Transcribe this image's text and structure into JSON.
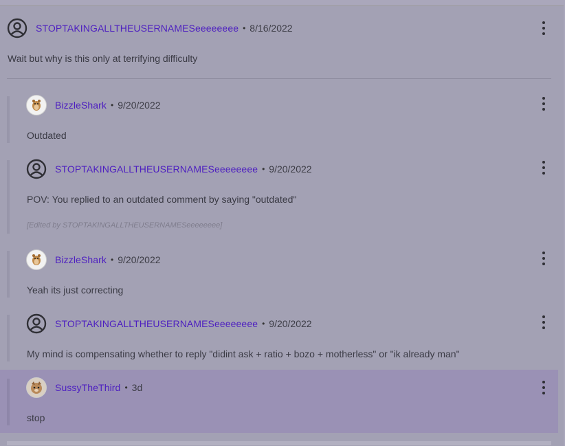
{
  "comments": [
    {
      "username": "STOPTAKINGALLTHEUSERNAMESeeeeeeee",
      "date": "8/16/2022",
      "text": "Wait but why is this only at terrifying difficulty",
      "avatar": "user-circle-icon"
    },
    {
      "username": "BizzleShark",
      "date": "9/20/2022",
      "text": "Outdated",
      "avatar": "hamster-avatar"
    },
    {
      "username": "STOPTAKINGALLTHEUSERNAMESeeeeeeee",
      "date": "9/20/2022",
      "text": "POV: You replied to an outdated comment by saying \"outdated\"",
      "edited": "[Edited by STOPTAKINGALLTHEUSERNAMESeeeeeeee]",
      "avatar": "user-circle-icon"
    },
    {
      "username": "BizzleShark",
      "date": "9/20/2022",
      "text": "Yeah its just correcting",
      "avatar": "hamster-avatar"
    },
    {
      "username": "STOPTAKINGALLTHEUSERNAMESeeeeeeee",
      "date": "9/20/2022",
      "text": "My mind is compensating whether to reply \"didint ask + ratio + bozo + motherless\" or \"ik already man\"",
      "avatar": "user-circle-icon"
    },
    {
      "username": "SussyTheThird",
      "date": "3d",
      "text": "stop",
      "avatar": "cat-avatar",
      "highlighted": true
    }
  ],
  "separator": "•",
  "colors": {
    "username": "#4d1fc0",
    "highlight": "#9a91b5",
    "background": "#a3a1b4"
  }
}
